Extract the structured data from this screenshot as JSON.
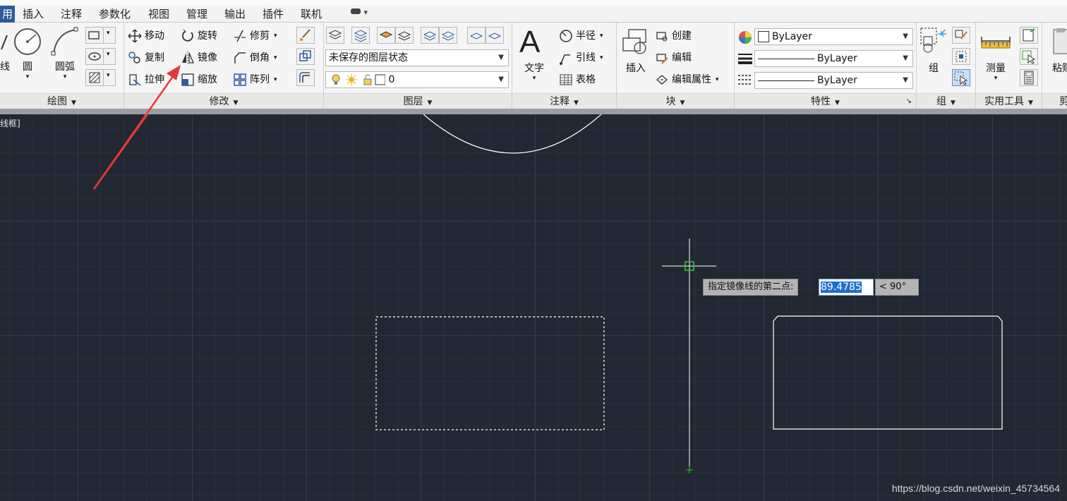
{
  "tabs": [
    "用",
    "插入",
    "注释",
    "参数化",
    "视图",
    "管理",
    "输出",
    "插件",
    "联机"
  ],
  "tab_extra": "▾",
  "draw_panel": {
    "title": "绘图",
    "line_label": "线",
    "circle_label": "圆",
    "arc_label": "圆弧"
  },
  "modify_panel": {
    "title": "修改",
    "move": "移动",
    "rotate": "旋转",
    "trim": "修剪",
    "copy": "复制",
    "mirror": "镜像",
    "fillet": "倒角",
    "stretch": "拉伸",
    "scale": "缩放",
    "array": "阵列"
  },
  "layers_panel": {
    "title": "图层",
    "layer_state": "未保存的图层状态",
    "current_layer": "0"
  },
  "annotation_panel": {
    "title": "注释",
    "text": "文字",
    "dimension": "半径",
    "leader": "引线",
    "table": "表格"
  },
  "block_panel": {
    "title": "块",
    "insert": "插入",
    "create": "创建",
    "edit": "编辑",
    "edit_attributes": "编辑属性"
  },
  "properties_panel": {
    "title": "特性",
    "color": "ByLayer",
    "linetype": "ByLayer",
    "lineweight": "ByLayer"
  },
  "group_panel": {
    "title": "组",
    "group": "组"
  },
  "utilities_panel": {
    "title": "实用工具",
    "measure": "测量"
  },
  "clipboard_panel": {
    "title": "剪",
    "paste": "粘贴"
  },
  "canvas": {
    "view_label": "线框]",
    "prompt": "指定镜像线的第二点:",
    "value": "89.4785",
    "angle": "< 90°"
  },
  "watermark": "https://blog.csdn.net/weixin_45734564",
  "colors": {
    "canvas_bg": "#212833",
    "accent": "#2e5b9b",
    "arrow": "#e8373a",
    "snap_marker": "#2bd12b"
  }
}
